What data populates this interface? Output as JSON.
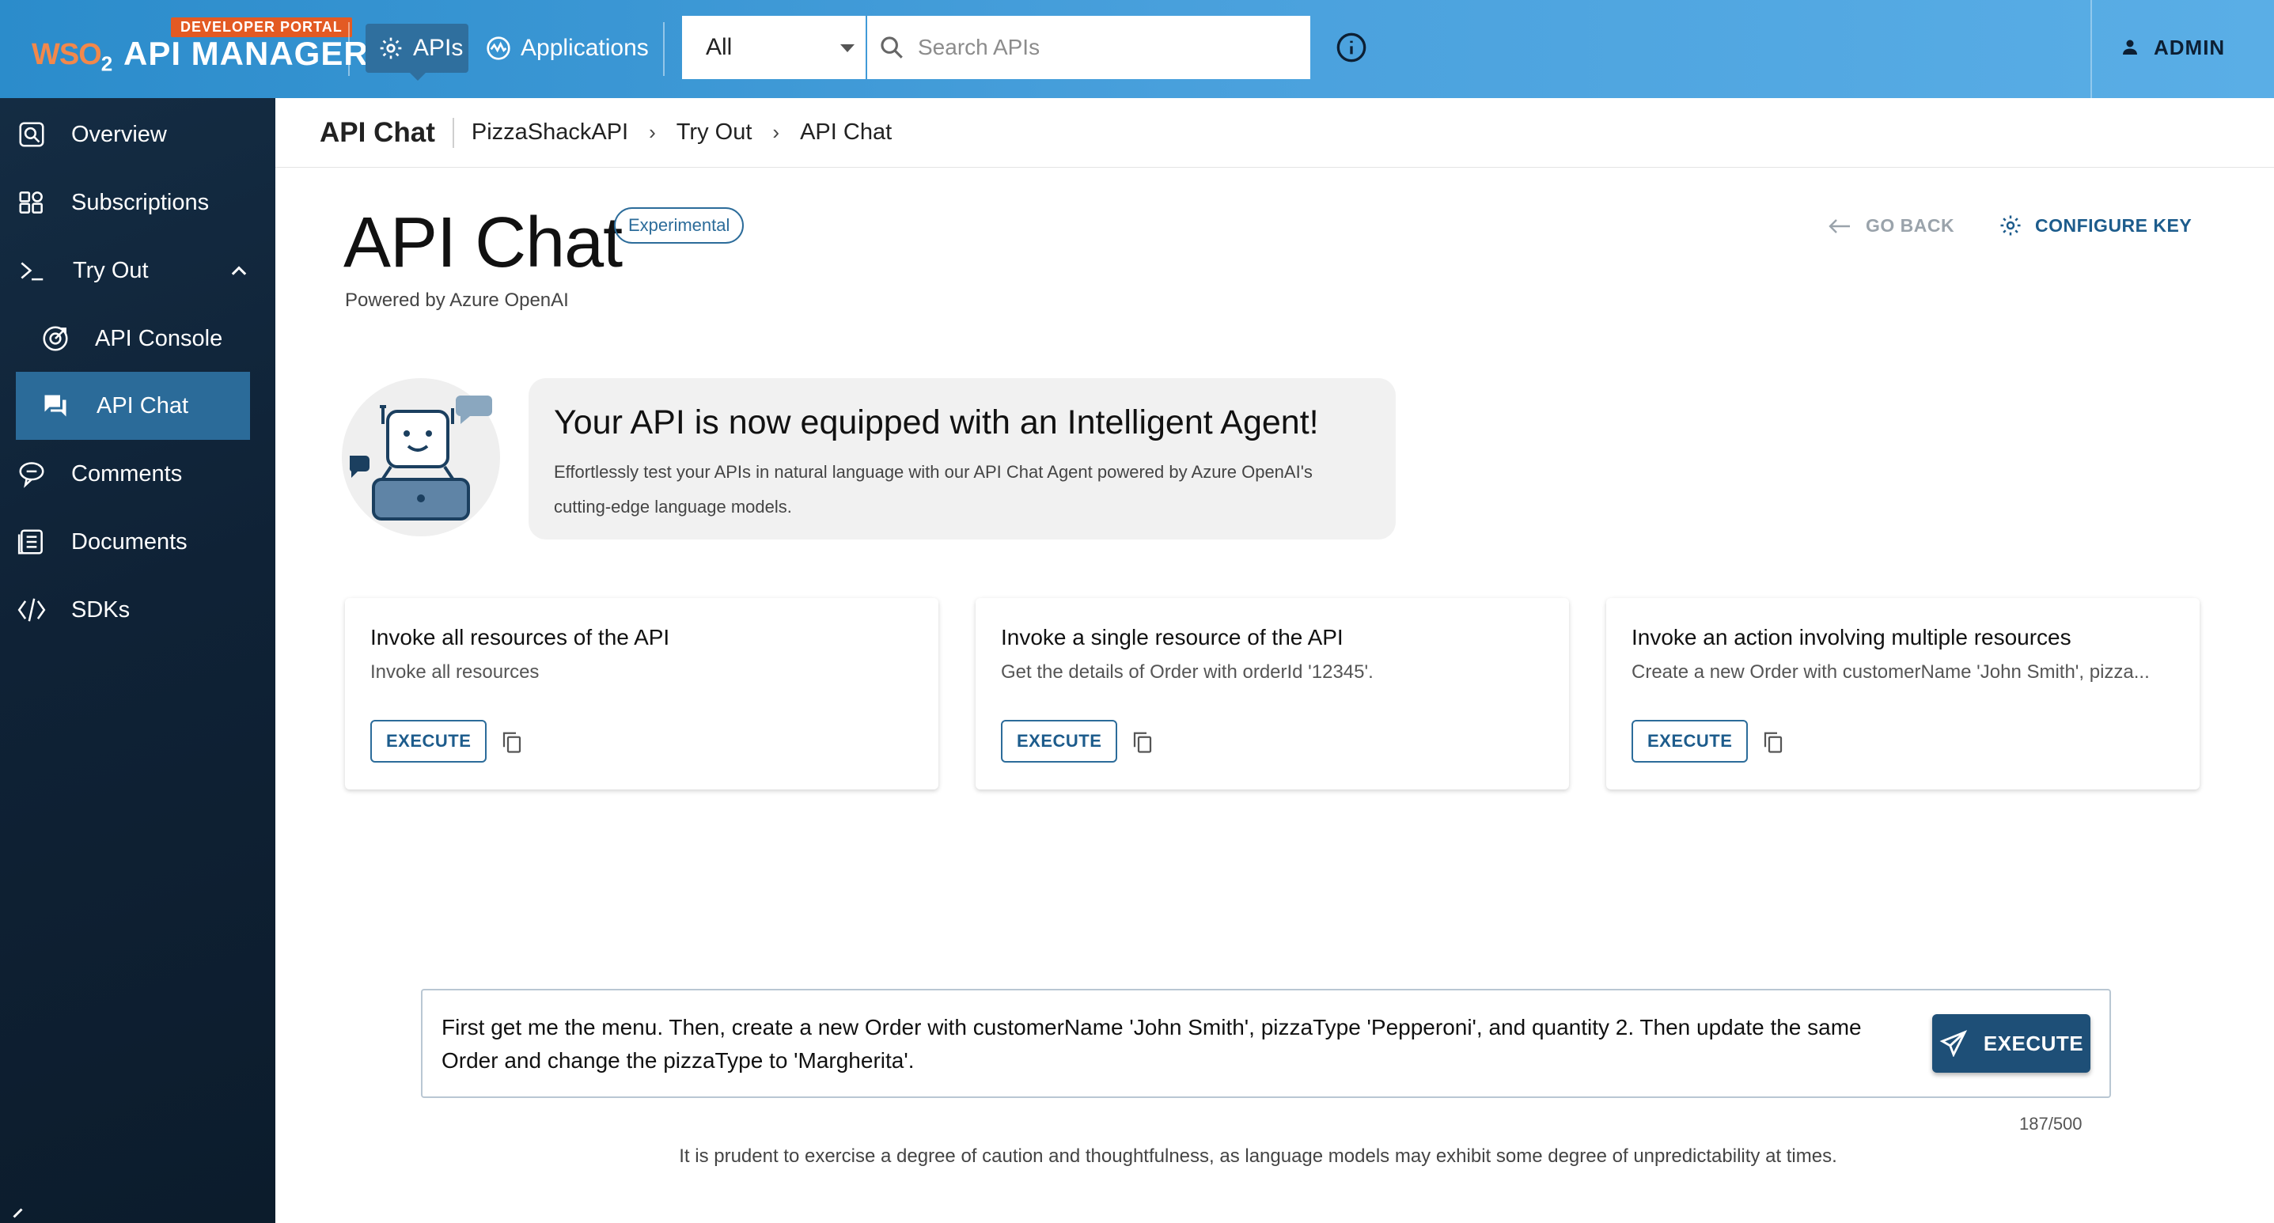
{
  "header": {
    "portal_badge": "DEVELOPER PORTAL",
    "logo_wso": "WSO",
    "logo_sub": "2",
    "product_name": "API MANAGER",
    "nav": {
      "apis": "APIs",
      "applications": "Applications"
    },
    "filter_value": "All",
    "search_placeholder": "Search APIs",
    "user": "ADMIN",
    "colors": {
      "bar_start": "#2b8ccb",
      "bar_end": "#5aaee6",
      "badge": "#e35a23"
    }
  },
  "sidebar": {
    "items": [
      {
        "label": "Overview",
        "icon": "overview-icon"
      },
      {
        "label": "Subscriptions",
        "icon": "subscriptions-icon"
      },
      {
        "label": "Try Out",
        "icon": "terminal-icon",
        "expanded": true
      },
      {
        "label": "API Console",
        "icon": "api-console-icon"
      },
      {
        "label": "API Chat",
        "icon": "chat-icon",
        "active": true
      },
      {
        "label": "Comments",
        "icon": "comments-icon"
      },
      {
        "label": "Documents",
        "icon": "documents-icon"
      },
      {
        "label": "SDKs",
        "icon": "code-icon"
      }
    ]
  },
  "breadcrumb": {
    "title": "API Chat",
    "items": [
      "PizzaShackAPI",
      "Try Out",
      "API Chat"
    ]
  },
  "page": {
    "title": "API Chat",
    "badge": "Experimental",
    "powered_by": "Powered by Azure OpenAI",
    "go_back": "GO BACK",
    "configure_key": "CONFIGURE KEY"
  },
  "banner": {
    "heading": "Your API is now equipped with an Intelligent Agent!",
    "text": "Effortlessly test your APIs in natural language with our API Chat Agent powered by Azure OpenAI's cutting-edge language models."
  },
  "cards": [
    {
      "title": "Invoke all resources of the API",
      "text": "Invoke all resources",
      "button": "EXECUTE"
    },
    {
      "title": "Invoke a single resource of the API",
      "text": "Get the details of Order with orderId '12345'.",
      "button": "EXECUTE"
    },
    {
      "title": "Invoke an action involving multiple resources",
      "text": "Create a new Order with customerName 'John Smith', pizza...",
      "button": "EXECUTE"
    }
  ],
  "query": {
    "value": "First get me the menu. Then, create a new Order with customerName 'John Smith', pizzaType 'Pepperoni', and quantity 2. Then update the same Order and change the pizzaType to 'Margherita'.",
    "execute": "EXECUTE",
    "counter": "187/500"
  },
  "disclaimer": "It is prudent to exercise a degree of caution and thoughtfulness, as language models may exhibit some degree of unpredictability at times."
}
